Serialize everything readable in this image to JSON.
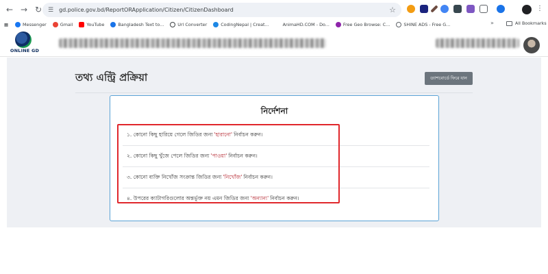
{
  "browser": {
    "url": "gd.police.gov.bd/ReportORApplication/Citizen/CitizenDashboard",
    "bookmarks": [
      {
        "label": "Messenger",
        "color": "#1877f2"
      },
      {
        "label": "Gmail",
        "color": "#ea4335"
      },
      {
        "label": "YouTube",
        "color": "#ff0000"
      },
      {
        "label": "Bangladesh Text to...",
        "color": "#1a73e8"
      },
      {
        "label": "Url Converter",
        "color": "#3c4043"
      },
      {
        "label": "CodingNepal | Creat...",
        "color": "#1e88e5"
      },
      {
        "label": "AnimaHD.COM - Do...",
        "color": "#ffffff"
      },
      {
        "label": "Free Geo Browse: C...",
        "color": "#8e24aa"
      },
      {
        "label": "SHINE ADS - Free G...",
        "color": "#5f6368"
      }
    ],
    "all_bookmarks_label": "All Bookmarks"
  },
  "site": {
    "logo_text": "ONLINE GD"
  },
  "page": {
    "title": "তথ্য এন্ট্রি প্রক্রিয়া",
    "back_button": "ড্যাশবোর্ডে ফিরে যান",
    "instructions_title": "নির্দেশনা",
    "items": [
      {
        "prefix": "১. কোনো কিছু হারিয়ে গেলে জিডির জন্য",
        "keyword": "'হারানো'",
        "suffix": "নির্বাচন করুন।"
      },
      {
        "prefix": "২. কোনো কিছু খুঁজে পেলে জিডির জন্য",
        "keyword": "'পাওয়া'",
        "suffix": "নির্বাচন করুন।"
      },
      {
        "prefix": "৩. কোনো ব্যক্তি নিখোঁজ সংক্রান্ত জিডির জন্য",
        "keyword": "'নিখোঁজ'",
        "suffix": "নির্বাচন করুন।"
      },
      {
        "prefix": "৪. উপরের ক্যাটাগরিগুলোর অন্তর্ভুক্ত নয় এমন জিডির জন্য",
        "keyword": "'অন্যান্য'",
        "suffix": "নির্বাচন করুন।"
      }
    ]
  },
  "colors": {
    "highlight_border": "#e0262b",
    "keyword": "#b3202a",
    "card_border": "#5aa2d6",
    "button_bg": "#6c757d"
  }
}
